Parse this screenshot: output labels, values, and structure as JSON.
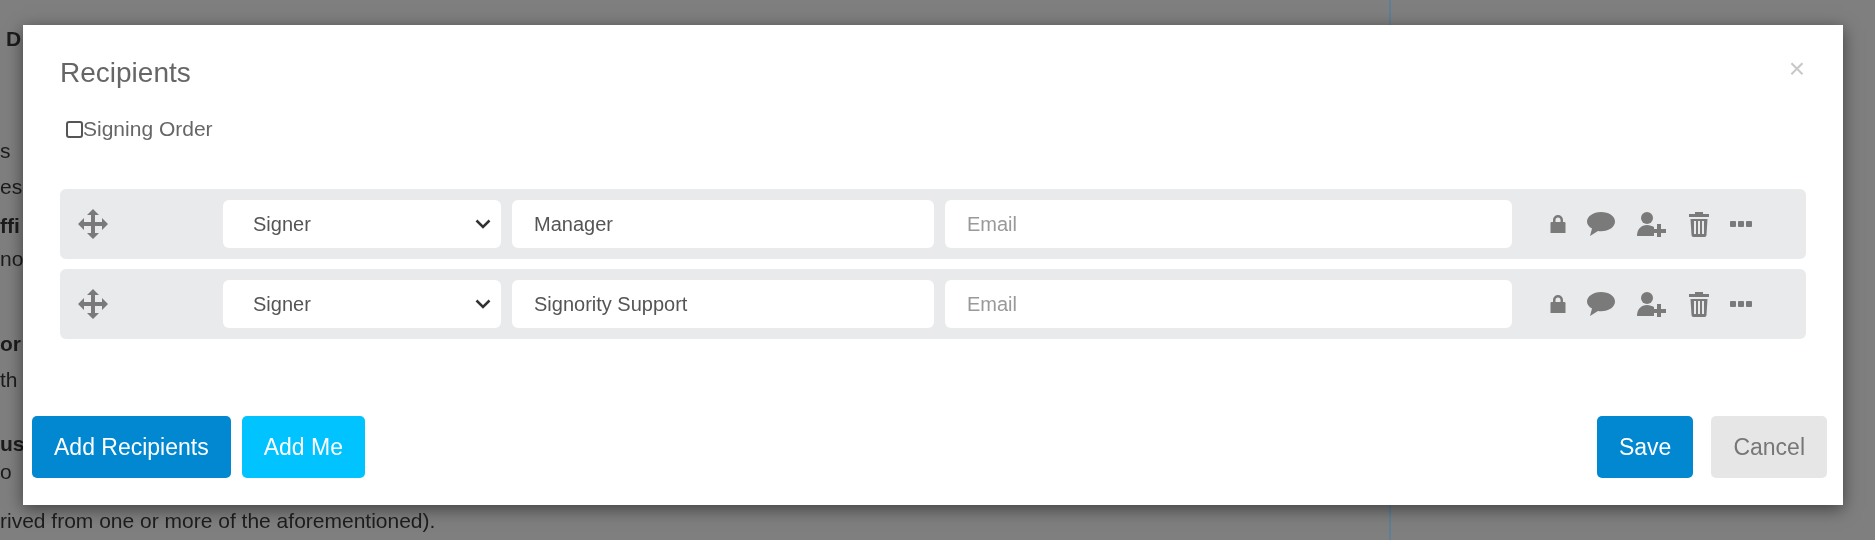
{
  "background_page": {
    "lines": [
      {
        "text": "D",
        "bold": true
      },
      {
        "text": "s",
        "bold": false
      },
      {
        "text": "es",
        "bold": false
      },
      {
        "text": "ffi",
        "bold": true
      },
      {
        "text": "no",
        "bold": false
      },
      {
        "text": "or",
        "bold": true
      },
      {
        "text": "th",
        "bold": false
      },
      {
        "text": "us",
        "bold": true
      },
      {
        "text": "o",
        "bold": false
      },
      {
        "text": "rived from one or more of the aforementioned).",
        "bold": false
      }
    ]
  },
  "dialog": {
    "title": "Recipients",
    "close": "×",
    "signing_order": {
      "label": "Signing Order",
      "checked": false
    },
    "recipients": [
      {
        "role": "Signer",
        "name": "Manager",
        "email_placeholder": "Email"
      },
      {
        "role": "Signer",
        "name": "Signority Support",
        "email_placeholder": "Email"
      }
    ],
    "left_buttons": [
      {
        "label": "Add Recipients",
        "kind": "primary"
      },
      {
        "label": "Add Me",
        "kind": "info"
      }
    ],
    "right_buttons": [
      {
        "label": "Save",
        "kind": "primary"
      },
      {
        "label": "Cancel",
        "kind": "secondary"
      }
    ]
  }
}
